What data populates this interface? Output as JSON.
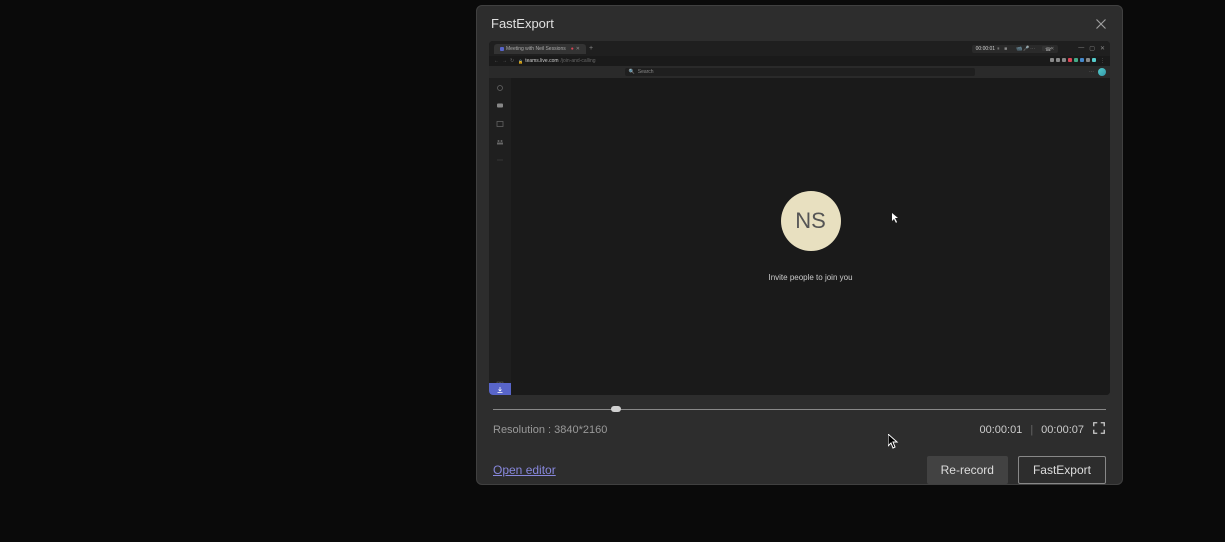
{
  "modal": {
    "title": "FastExport"
  },
  "preview": {
    "tab_title": "Meeting with Neil Sessions",
    "timer": "00:00:01",
    "url_host": "teams.live.com",
    "url_path": "/join-and-calling",
    "search_placeholder": "Search",
    "avatar_initials": "NS",
    "invite_text": "Invite people to join you"
  },
  "timeline": {
    "resolution": "Resolution : 3840*2160",
    "current_time": "00:00:01",
    "total_time": "00:00:07"
  },
  "footer": {
    "editor_link": "Open editor",
    "rerecord_label": "Re-record",
    "export_label": "FastExport"
  }
}
